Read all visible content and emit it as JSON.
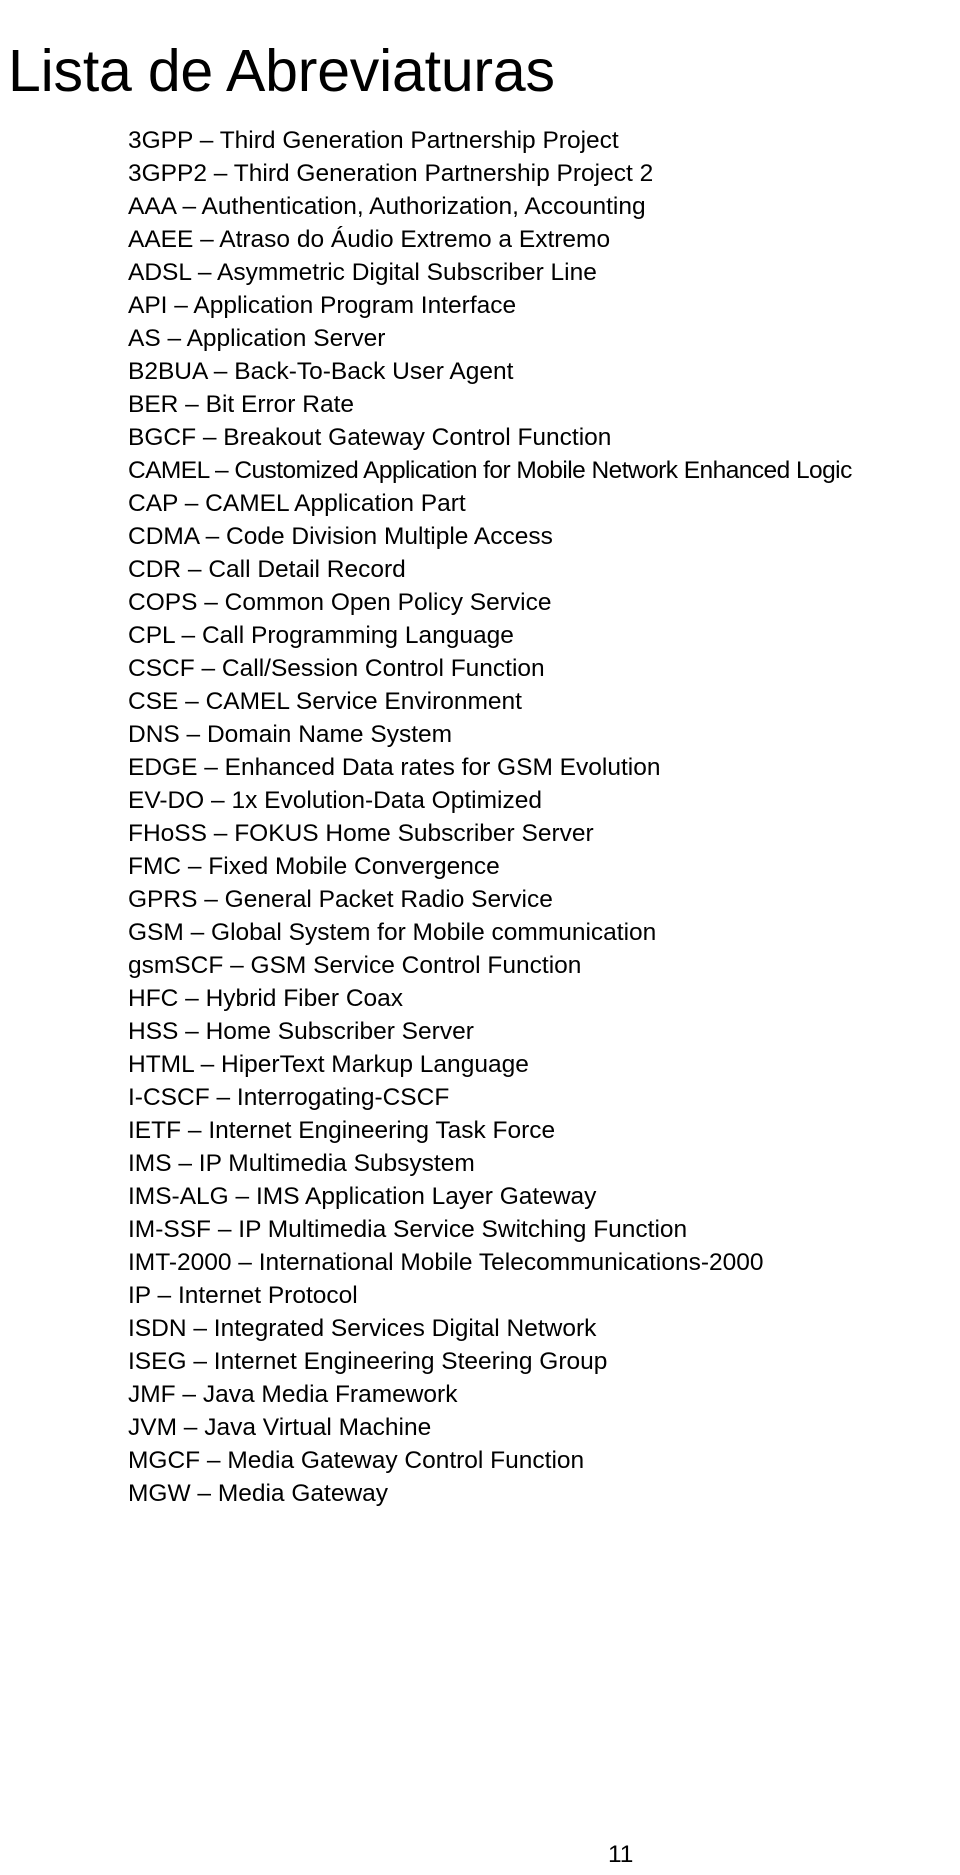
{
  "document": {
    "title": "Lista de Abreviaturas",
    "page_number": "11",
    "language": "pt-BR",
    "text_color": "#000000",
    "background_color": "#ffffff"
  },
  "abbreviations": [
    {
      "term": "3GPP",
      "separator": "–",
      "definition": "Third Generation Partnership Project",
      "line": "3GPP – Third Generation Partnership Project"
    },
    {
      "term": "3GPP2",
      "separator": "–",
      "definition": "Third Generation Partnership Project 2",
      "line": "3GPP2 – Third Generation Partnership Project 2"
    },
    {
      "term": "AAA",
      "separator": "–",
      "definition": "Authentication, Authorization, Accounting",
      "line": "AAA – Authentication, Authorization, Accounting"
    },
    {
      "term": "AAEE",
      "separator": "–",
      "definition": "Atraso do Áudio Extremo a Extremo",
      "line": "AAEE – Atraso do Áudio Extremo a Extremo"
    },
    {
      "term": "ADSL",
      "separator": "–",
      "definition": "Asymmetric Digital Subscriber Line",
      "line": "ADSL – Asymmetric Digital Subscriber Line"
    },
    {
      "term": "API",
      "separator": "–",
      "definition": "Application Program Interface",
      "line": "API – Application Program Interface"
    },
    {
      "term": "AS",
      "separator": "–",
      "definition": "Application Server",
      "line": "AS – Application Server"
    },
    {
      "term": "B2BUA",
      "separator": "–",
      "definition": "Back-To-Back User Agent",
      "line": "B2BUA – Back-To-Back User Agent"
    },
    {
      "term": "BER",
      "separator": "–",
      "definition": "Bit Error Rate",
      "line": "BER – Bit Error Rate"
    },
    {
      "term": "BGCF",
      "separator": "–",
      "definition": "Breakout Gateway Control Function",
      "line": "BGCF – Breakout Gateway Control Function"
    },
    {
      "term": "CAMEL",
      "separator": "–",
      "definition": "Customized Application for Mobile Network Enhanced Logic",
      "line": "CAMEL – Customized Application for Mobile Network Enhanced Logic"
    },
    {
      "term": "CAP",
      "separator": "–",
      "definition": "CAMEL Application Part",
      "line": "CAP – CAMEL Application Part"
    },
    {
      "term": "CDMA",
      "separator": "–",
      "definition": "Code Division Multiple Access",
      "line": "CDMA – Code Division Multiple Access"
    },
    {
      "term": "CDR",
      "separator": "–",
      "definition": "Call Detail Record",
      "line": "CDR – Call Detail Record"
    },
    {
      "term": "COPS",
      "separator": "–",
      "definition": "Common Open Policy Service",
      "line": "COPS – Common Open Policy Service"
    },
    {
      "term": "CPL",
      "separator": "–",
      "definition": "Call Programming Language",
      "line": "CPL – Call Programming Language"
    },
    {
      "term": "CSCF",
      "separator": "–",
      "definition": "Call/Session Control Function",
      "line": "CSCF – Call/Session Control Function"
    },
    {
      "term": "CSE",
      "separator": "–",
      "definition": "CAMEL Service Environment",
      "line": "CSE – CAMEL Service Environment"
    },
    {
      "term": "DNS",
      "separator": "–",
      "definition": "Domain Name System",
      "line": "DNS – Domain Name System"
    },
    {
      "term": "EDGE",
      "separator": "–",
      "definition": "Enhanced Data rates for GSM Evolution",
      "line": "EDGE – Enhanced Data rates for GSM Evolution"
    },
    {
      "term": "EV-DO",
      "separator": "–",
      "definition": "1x Evolution-Data Optimized",
      "line": "EV-DO – 1x Evolution-Data Optimized"
    },
    {
      "term": "FHoSS",
      "separator": "–",
      "definition": "FOKUS Home Subscriber Server",
      "line": "FHoSS – FOKUS Home Subscriber Server"
    },
    {
      "term": "FMC",
      "separator": "–",
      "definition": "Fixed Mobile Convergence",
      "line": "FMC – Fixed Mobile Convergence"
    },
    {
      "term": "GPRS",
      "separator": "–",
      "definition": "General Packet Radio Service",
      "line": "GPRS – General Packet Radio Service"
    },
    {
      "term": "GSM",
      "separator": "–",
      "definition": "Global System for Mobile communication",
      "line": "GSM – Global System for Mobile communication"
    },
    {
      "term": "gsmSCF",
      "separator": "–",
      "definition": "GSM Service Control Function",
      "line": "gsmSCF – GSM Service Control Function"
    },
    {
      "term": "HFC",
      "separator": "–",
      "definition": "Hybrid Fiber Coax",
      "line": "HFC – Hybrid Fiber Coax"
    },
    {
      "term": "HSS",
      "separator": "–",
      "definition": "Home Subscriber Server",
      "line": "HSS – Home Subscriber Server"
    },
    {
      "term": "HTML",
      "separator": "–",
      "definition": "HiperText Markup Language",
      "line": "HTML – HiperText Markup Language"
    },
    {
      "term": "I-CSCF",
      "separator": "–",
      "definition": "Interrogating-CSCF",
      "line": "I-CSCF – Interrogating-CSCF"
    },
    {
      "term": "IETF",
      "separator": "–",
      "definition": "Internet Engineering Task Force",
      "line": "IETF – Internet Engineering Task Force"
    },
    {
      "term": "IMS",
      "separator": "–",
      "definition": "IP Multimedia Subsystem",
      "line": "IMS – IP Multimedia Subsystem"
    },
    {
      "term": "IMS-ALG",
      "separator": "–",
      "definition": "IMS Application Layer Gateway",
      "line": "IMS-ALG – IMS Application Layer Gateway"
    },
    {
      "term": "IM-SSF",
      "separator": "–",
      "definition": "IP Multimedia Service Switching Function",
      "line": "IM-SSF – IP Multimedia Service Switching Function"
    },
    {
      "term": "IMT-2000",
      "separator": "–",
      "definition": "International Mobile Telecommunications-2000",
      "line": "IMT-2000 – International Mobile Telecommunications-2000"
    },
    {
      "term": "IP",
      "separator": "–",
      "definition": "Internet Protocol",
      "line": "IP – Internet Protocol"
    },
    {
      "term": "ISDN",
      "separator": "–",
      "definition": "Integrated Services Digital Network",
      "line": "ISDN – Integrated Services Digital Network"
    },
    {
      "term": "ISEG",
      "separator": "–",
      "definition": "Internet Engineering Steering Group",
      "line": "ISEG – Internet Engineering Steering Group"
    },
    {
      "term": "JMF",
      "separator": "–",
      "definition": "Java Media Framework",
      "line": "JMF – Java Media Framework"
    },
    {
      "term": "JVM",
      "separator": "–",
      "definition": "Java Virtual Machine",
      "line": "JVM – Java Virtual Machine"
    },
    {
      "term": "MGCF",
      "separator": "–",
      "definition": "Media Gateway Control Function",
      "line": "MGCF – Media Gateway Control Function"
    },
    {
      "term": "MGW",
      "separator": "–",
      "definition": "Media Gateway",
      "line": "MGW – Media Gateway"
    }
  ]
}
